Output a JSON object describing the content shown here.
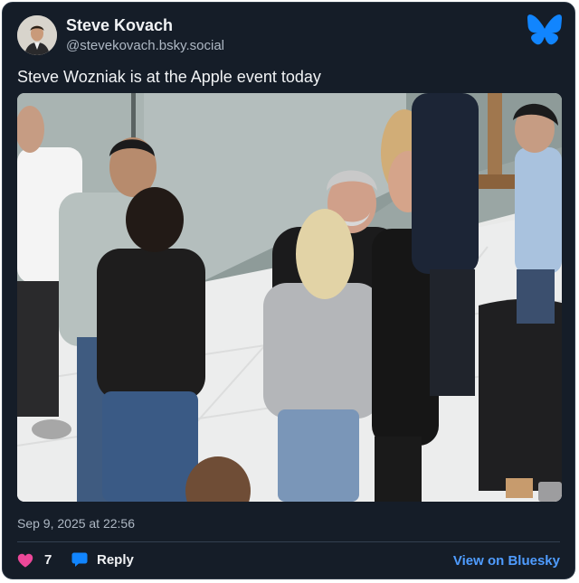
{
  "post": {
    "author_name": "Steve Kovach",
    "author_handle": "@stevekovach.bsky.social",
    "text": "Steve Wozniak is at the Apple event today",
    "timestamp": "Sep 9, 2025 at 22:56"
  },
  "footer": {
    "like_count": "7",
    "reply_label": "Reply",
    "view_label": "View on Bluesky"
  },
  "colors": {
    "card_background": "#151d28",
    "brand_blue": "#1185fe",
    "link_blue": "#4f9cff",
    "like_pink": "#ec4899"
  },
  "icons": {
    "logo": "bluesky-butterfly-icon",
    "like": "heart-icon",
    "reply": "speech-bubble-icon"
  }
}
